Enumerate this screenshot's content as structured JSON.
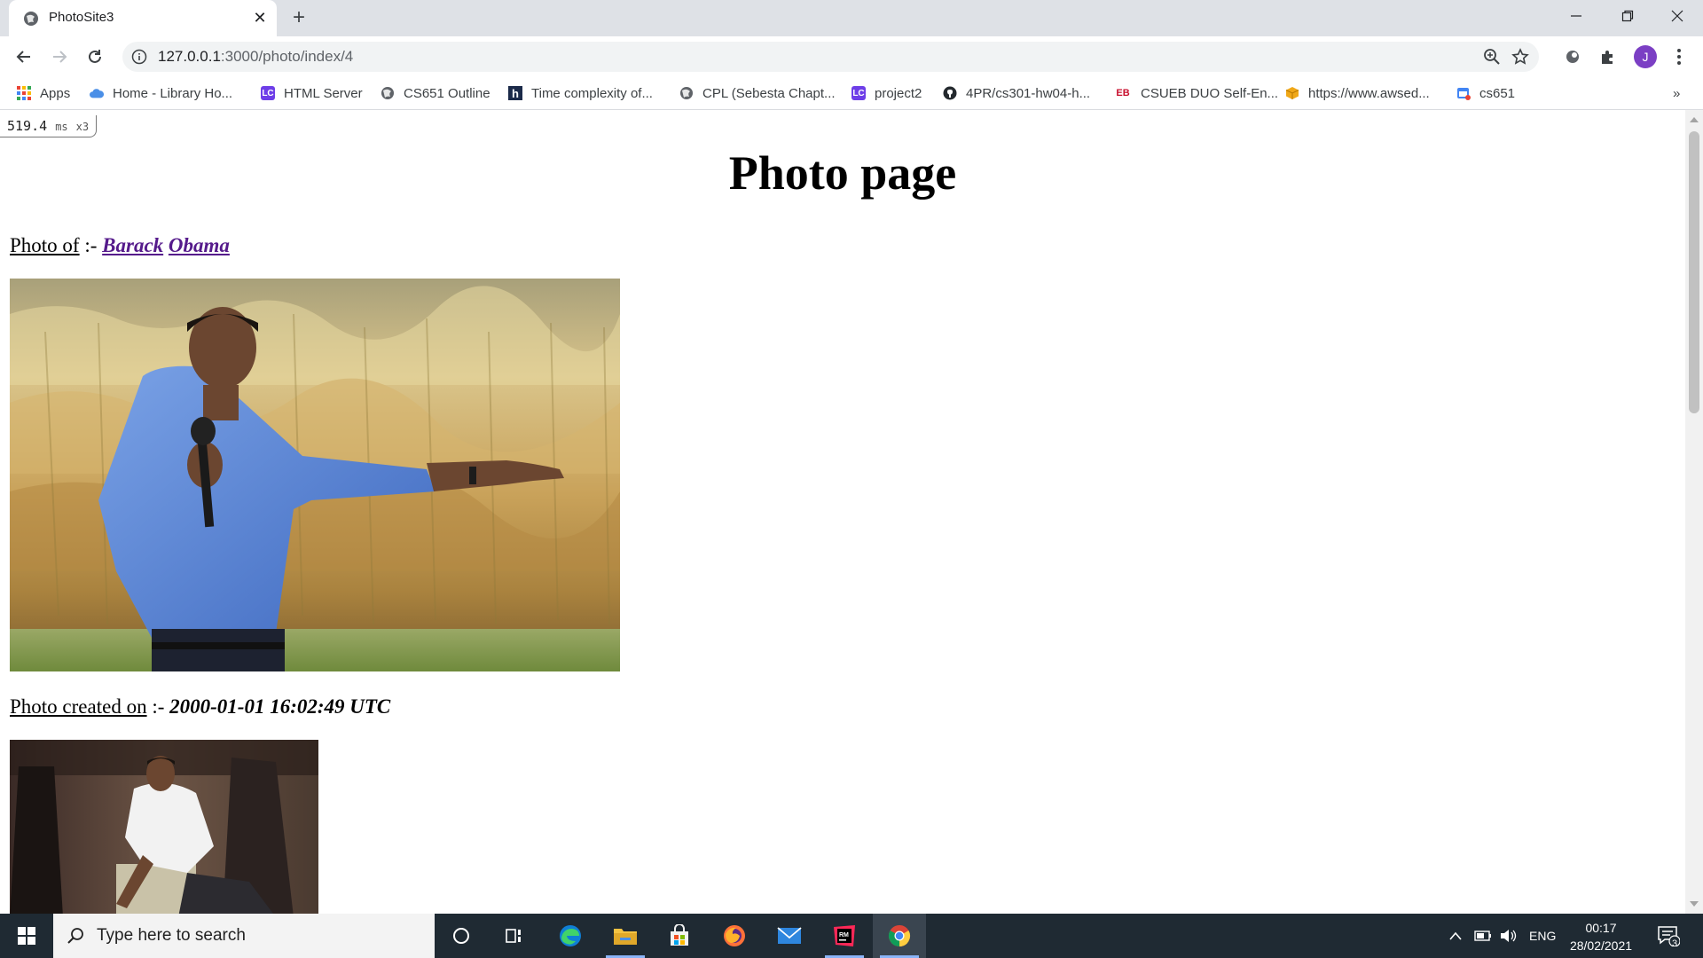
{
  "browser": {
    "tab_title": "PhotoSite3",
    "url_host": "127.0.0.1",
    "url_path": ":3000/photo/index/4",
    "avatar_letter": "J",
    "bookmarks": [
      {
        "label": "Apps",
        "icon": "apps-grid-icon",
        "color": "#e8453c"
      },
      {
        "label": "Home - Library Ho...",
        "icon": "cloud-icon",
        "color": "#4a8fe7"
      },
      {
        "label": "HTML Server",
        "icon": "lc-icon",
        "color": "#6e3ee8"
      },
      {
        "label": "CS651 Outline",
        "icon": "globe-icon",
        "color": "#5f6368"
      },
      {
        "label": "Time complexity of...",
        "icon": "h-icon",
        "color": "#1b2a49"
      },
      {
        "label": "CPL (Sebesta Chapt...",
        "icon": "globe-icon",
        "color": "#5f6368"
      },
      {
        "label": "project2",
        "icon": "lc-icon",
        "color": "#6e3ee8"
      },
      {
        "label": "4PR/cs301-hw04-h...",
        "icon": "github-icon",
        "color": "#24292e"
      },
      {
        "label": "CSUEB DUO Self-En...",
        "icon": "eb-icon",
        "color": "#c8102e"
      },
      {
        "label": "https://www.awsed...",
        "icon": "package-icon",
        "color": "#f0a818"
      },
      {
        "label": "cs651",
        "icon": "calendar-icon",
        "color": "#4285f4"
      }
    ],
    "overflow_label": "»"
  },
  "page": {
    "timer_value": "519.4",
    "timer_unit": "ms",
    "timer_count": "x3",
    "title": "Photo page",
    "photo_of_label": "Photo of",
    "separator": ":-",
    "first_name": "Barack",
    "last_name": "Obama",
    "created_label": "Photo created on",
    "created_value": "2000-01-01 16:02:49 UTC"
  },
  "taskbar": {
    "search_placeholder": "Type here to search",
    "language": "ENG",
    "time": "00:17",
    "date": "28/02/2021",
    "notification_count": "3"
  }
}
